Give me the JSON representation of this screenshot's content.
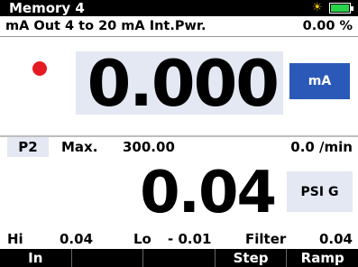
{
  "title_bar": {
    "title": "Memory 4",
    "icons": [
      "sun-icon",
      "battery-icon"
    ],
    "battery_color": "#29d34a"
  },
  "output": {
    "label": "mA Out  4 to 20 mA  Int.Pwr.",
    "percent": "0.00 %"
  },
  "main_reading": {
    "value": "0.000",
    "unit": "mA",
    "indicator_color": "#e51b24"
  },
  "pressure": {
    "channel": "P2",
    "max_label": "Max.",
    "max_value": "300.00",
    "rate": "0.0 /min",
    "value": "0.04",
    "unit": "PSI G"
  },
  "stats": {
    "hi_label": "Hi",
    "hi_value": "0.04",
    "lo_label": "Lo",
    "lo_value": "- 0.01",
    "filter_label": "Filter",
    "filter_value": "0.04"
  },
  "softkeys": [
    "In",
    "",
    "",
    "Step",
    "Ramp"
  ]
}
